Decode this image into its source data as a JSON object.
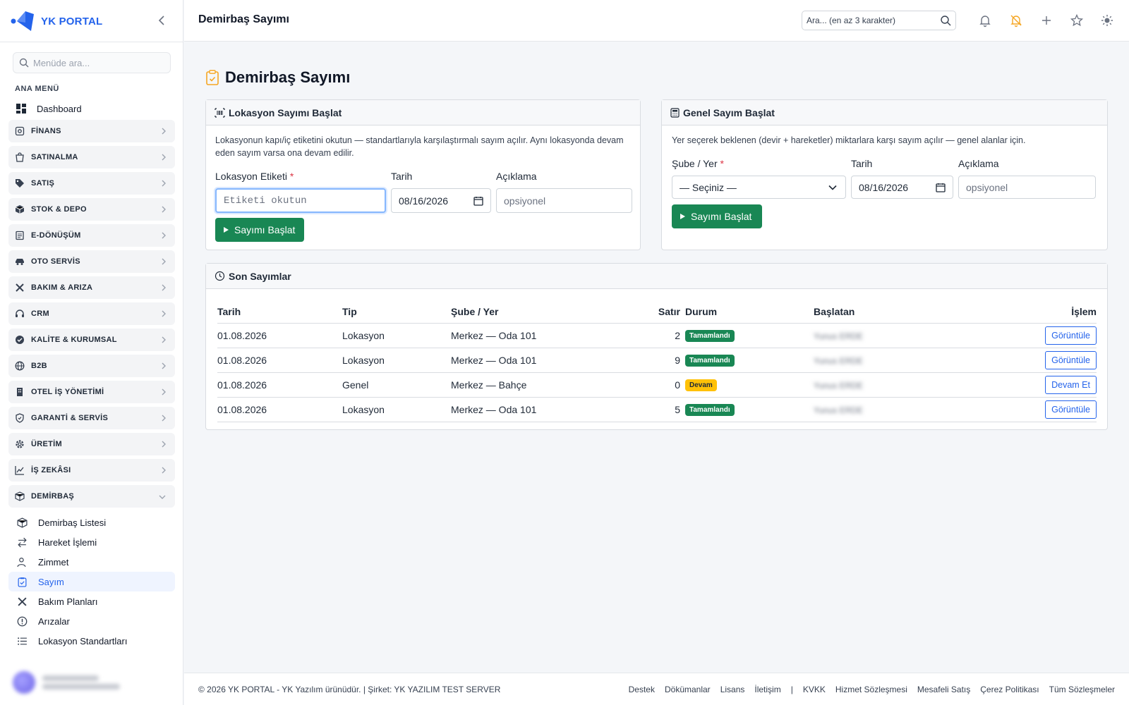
{
  "app": {
    "name": "YK PORTAL"
  },
  "sidebar": {
    "search_placeholder": "Menüde ara...",
    "menu_label": "ANA MENÜ",
    "dashboard": "Dashboard",
    "groups": [
      {
        "label": "FİNANS",
        "icon": "finance-icon"
      },
      {
        "label": "SATINALMA",
        "icon": "shopping-icon"
      },
      {
        "label": "SATIŞ",
        "icon": "tag-icon"
      },
      {
        "label": "STOK & DEPO",
        "icon": "box-icon"
      },
      {
        "label": "E-DÖNÜŞÜM",
        "icon": "document-icon"
      },
      {
        "label": "OTO SERVİS",
        "icon": "car-icon"
      },
      {
        "label": "BAKIM & ARIZA",
        "icon": "tools-icon"
      },
      {
        "label": "CRM",
        "icon": "headset-icon"
      },
      {
        "label": "KALİTE & KURUMSAL",
        "icon": "badge-check-icon"
      },
      {
        "label": "B2B",
        "icon": "globe-icon"
      },
      {
        "label": "OTEL İŞ YÖNETİMİ",
        "icon": "building-icon"
      },
      {
        "label": "GARANTİ & SERVİS",
        "icon": "shield-icon"
      },
      {
        "label": "ÜRETİM",
        "icon": "gear-icon"
      },
      {
        "label": "İŞ ZEKÂSI",
        "icon": "chart-line-icon"
      },
      {
        "label": "DEMİRBAŞ",
        "icon": "box-icon"
      }
    ],
    "sub_items": [
      {
        "label": "Demirbaş Listesi",
        "active": false
      },
      {
        "label": "Hareket İşlemi",
        "active": false
      },
      {
        "label": "Zimmet",
        "active": false
      },
      {
        "label": "Sayım",
        "active": true
      },
      {
        "label": "Bakım Planları",
        "active": false
      },
      {
        "label": "Arızalar",
        "active": false
      },
      {
        "label": "Lokasyon Standartları",
        "active": false
      }
    ]
  },
  "topbar": {
    "title": "Demirbaş Sayımı",
    "search_placeholder": "Ara... (en az 3 karakter)"
  },
  "main": {
    "title": "Demirbaş Sayımı",
    "location_card": {
      "title": "Lokasyon Sayımı Başlat",
      "description": "Lokasyonun kapı/iç etiketini okutun — standartlarıyla karşılaştırmalı sayım açılır. Aynı lokasyonda devam eden sayım varsa ona devam edilir.",
      "label_field": "Lokasyon Etiketi",
      "label_placeholder": "Etiketi okutun",
      "date_label": "Tarih",
      "date_value": "08/16/2026",
      "note_label": "Açıklama",
      "note_placeholder": "opsiyonel",
      "button": "Sayımı Başlat"
    },
    "general_card": {
      "title": "Genel Sayım Başlat",
      "description": "Yer seçerek beklenen (devir + hareketler) miktarlara karşı sayım açılır — genel alanlar için.",
      "place_label": "Şube / Yer",
      "place_value": "— Seçiniz —",
      "date_label": "Tarih",
      "date_value": "08/16/2026",
      "note_label": "Açıklama",
      "note_placeholder": "opsiyonel",
      "button": "Sayımı Başlat"
    },
    "recent": {
      "title": "Son Sayımlar",
      "columns": [
        "Tarih",
        "Tip",
        "Şube / Yer",
        "Satır",
        "Durum",
        "Başlatan",
        "İşlem"
      ],
      "rows": [
        {
          "date": "01.08.2026",
          "type": "Lokasyon",
          "place": "Merkez — Oda 101",
          "lines": "2",
          "status": "Tamamlandı",
          "status_kind": "done",
          "starter": "Yunus ERDE",
          "action": "Görüntüle"
        },
        {
          "date": "01.08.2026",
          "type": "Lokasyon",
          "place": "Merkez — Oda 101",
          "lines": "9",
          "status": "Tamamlandı",
          "status_kind": "done",
          "starter": "Yunus ERDE",
          "action": "Görüntüle"
        },
        {
          "date": "01.08.2026",
          "type": "Genel",
          "place": "Merkez — Bahçe",
          "lines": "0",
          "status": "Devam",
          "status_kind": "cont",
          "starter": "Yunus ERDE",
          "action": "Devam Et"
        },
        {
          "date": "01.08.2026",
          "type": "Lokasyon",
          "place": "Merkez — Oda 101",
          "lines": "5",
          "status": "Tamamlandı",
          "status_kind": "done",
          "starter": "Yunus ERDE",
          "action": "Görüntüle"
        }
      ]
    }
  },
  "footer": {
    "copyright": "© 2026 YK PORTAL - YK Yazılım ürünüdür. | Şirket: YK YAZILIM TEST SERVER",
    "links": [
      "Destek",
      "Dökümanlar",
      "Lisans",
      "İletişim",
      "|",
      "KVKK",
      "Hizmet Sözleşmesi",
      "Mesafeli Satış",
      "Çerez Politikası",
      "Tüm Sözleşmeler"
    ]
  },
  "colors": {
    "primary": "#2463eb",
    "success": "#198754",
    "warning": "#ffc107",
    "danger": "#dc3545"
  }
}
